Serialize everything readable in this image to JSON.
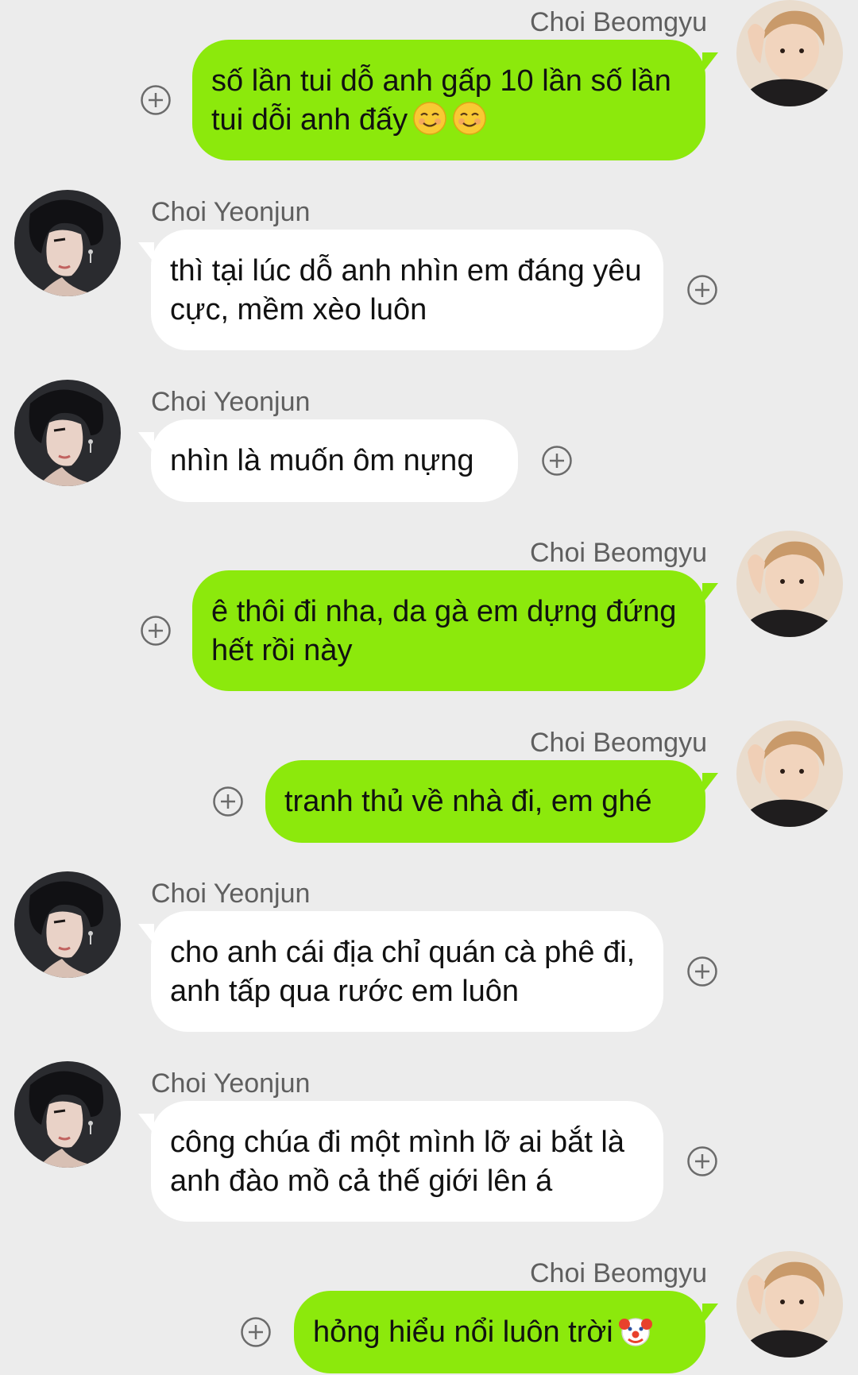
{
  "chat": {
    "messages": [
      {
        "sender": "Choi Beomgyu",
        "side": "right",
        "text": "số lần tui dỗ anh gấp 10 lần số lần tui dỗi anh đấy",
        "emoji": [
          "smiling-face-icon",
          "smiling-face-icon"
        ]
      },
      {
        "sender": "Choi Yeonjun",
        "side": "left",
        "text": "thì tại lúc dỗ anh nhìn em đáng yêu cực, mềm xèo luôn"
      },
      {
        "sender": "Choi Yeonjun",
        "side": "left",
        "text": "nhìn là muốn ôm nựng"
      },
      {
        "sender": "Choi Beomgyu",
        "side": "right",
        "text": "ê thôi đi nha, da gà em dựng đứng hết rồi này"
      },
      {
        "sender": "Choi Beomgyu",
        "side": "right",
        "text": "tranh thủ về nhà đi, em ghé"
      },
      {
        "sender": "Choi Yeonjun",
        "side": "left",
        "text": "cho anh cái địa chỉ quán cà phê đi, anh tấp qua rước em luôn"
      },
      {
        "sender": "Choi Yeonjun",
        "side": "left",
        "text": "công chúa đi một mình lỡ ai bắt là anh đào mồ cả thế giới lên á"
      },
      {
        "sender": "Choi Beomgyu",
        "side": "right",
        "text": "hỏng hiểu nổi luôn trời",
        "emoji": [
          "clown-face-icon"
        ]
      }
    ]
  },
  "colors": {
    "background": "#ececec",
    "outgoing_bubble": "#8ce90c",
    "incoming_bubble": "#ffffff",
    "sender_name": "#5f5f5f",
    "plus_icon": "#6b6b6b"
  }
}
